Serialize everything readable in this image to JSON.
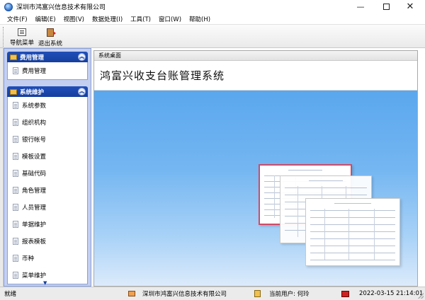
{
  "window": {
    "title": "深圳市鸿富兴信息技术有限公司",
    "min_glyph": "—",
    "close_glyph": "✕"
  },
  "menu": [
    "文件(F)",
    "编辑(E)",
    "视图(V)",
    "数据处理(I)",
    "工具(T)",
    "窗口(W)",
    "帮助(H)"
  ],
  "toolbar": {
    "nav_label": "导航菜单",
    "exit_label": "退出系统"
  },
  "sidebar": {
    "groups": [
      {
        "title": "费用管理",
        "items": [
          "费用管理"
        ]
      },
      {
        "title": "系统维护",
        "items": [
          "系统参数",
          "组织机构",
          "银行帐号",
          "模板设置",
          "基础代码",
          "角色管理",
          "人员管理",
          "单据维护",
          "报表模板",
          "币种",
          "菜单维护"
        ]
      }
    ],
    "collapse_glyph": "︽",
    "scroll_glyph": "▼"
  },
  "content": {
    "tab_label": "系统桌面",
    "banner_title": "鸿富兴收支台账管理系统"
  },
  "status": {
    "ready": "就绪",
    "company": "深圳市鸿富兴信息技术有限公司",
    "user": "当前用户: 何玲",
    "datetime": "2022-03-15 21:14:01"
  }
}
